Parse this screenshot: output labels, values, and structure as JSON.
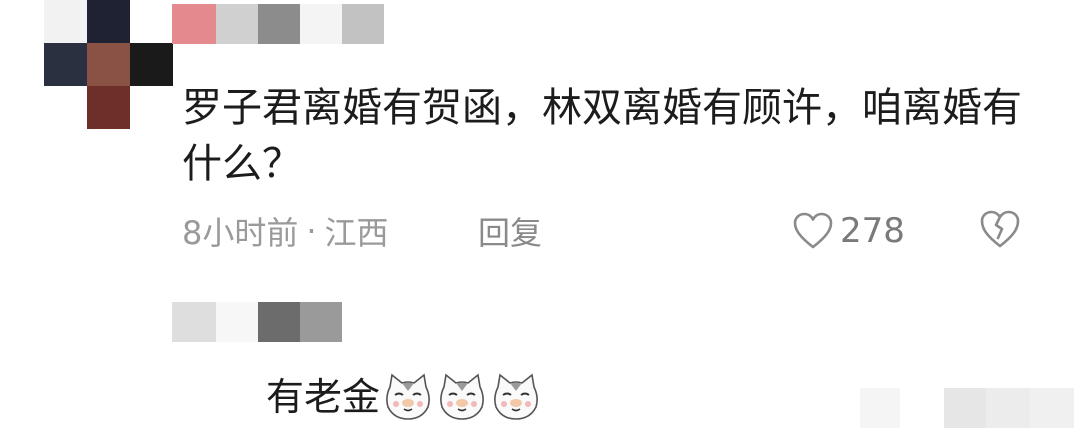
{
  "comment": {
    "text": "罗子君离婚有贺函，林双离婚有顾许，咱离婚有什么？",
    "time": "8小时前",
    "separator": "·",
    "location": "江西",
    "reply_label": "回复",
    "like_count": "278",
    "icons": {
      "like": "heart-outline-icon",
      "dislike": "broken-heart-icon"
    }
  },
  "reply": {
    "text": "有老金",
    "emoji": "cat-face-emoji",
    "emoji_count": 3
  },
  "colors": {
    "meta_text": "#9a9a9a",
    "body_text": "#1c1c1c",
    "icon_stroke": "#8a8a8a"
  }
}
